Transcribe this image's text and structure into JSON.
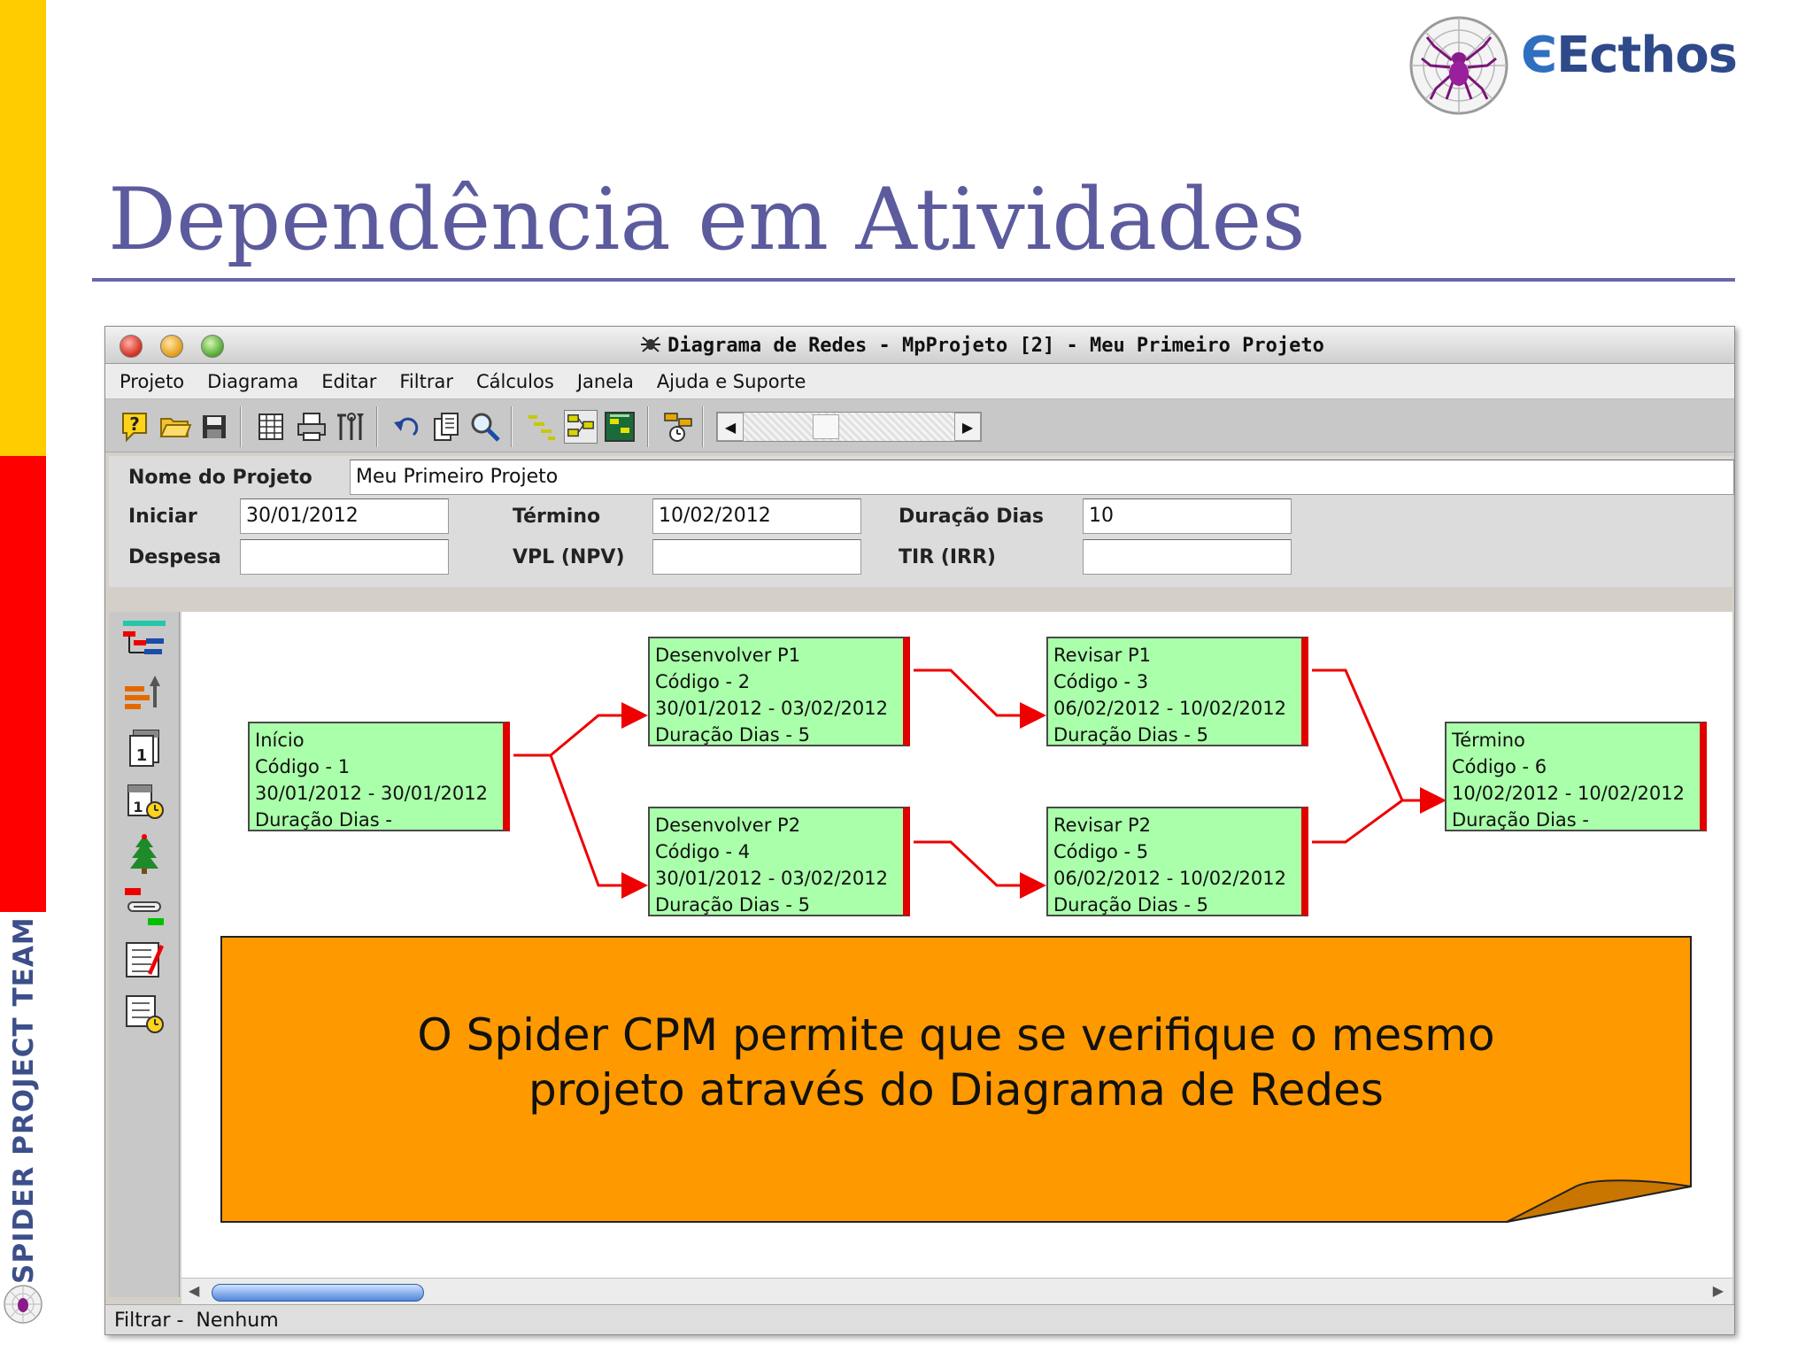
{
  "slide": {
    "title": "Dependência em Atividades",
    "logo_text": "Ecthos",
    "side_text": "SPIDER PROJECT TEAM"
  },
  "window": {
    "title": "Diagrama de Redes - MpProjeto [2] - Meu Primeiro Projeto",
    "menu": [
      "Projeto",
      "Diagrama",
      "Editar",
      "Filtrar",
      "Cálculos",
      "Janela",
      "Ajuda e Suporte"
    ],
    "project": {
      "name_label": "Nome do Projeto",
      "name_value": "Meu Primeiro Projeto",
      "start_label": "Iniciar",
      "start_value": "30/01/2012",
      "end_label": "Término",
      "end_value": "10/02/2012",
      "duration_label": "Duração Dias",
      "duration_value": "10",
      "expense_label": "Despesa",
      "expense_value": "",
      "npv_label": "VPL (NPV)",
      "npv_value": "",
      "irr_label": "TIR (IRR)",
      "irr_value": ""
    },
    "status": {
      "label": "Filtrar -",
      "value": "Nenhum"
    }
  },
  "network": {
    "nodes": [
      {
        "name": "Início",
        "code": "Código - 1",
        "dates": "30/01/2012  -  30/01/2012",
        "duration": "Duração Dias -"
      },
      {
        "name": "Desenvolver P1",
        "code": "Código - 2",
        "dates": "30/01/2012  -  03/02/2012",
        "duration": "Duração Dias - 5"
      },
      {
        "name": "Revisar P1",
        "code": "Código - 3",
        "dates": "06/02/2012  -  10/02/2012",
        "duration": "Duração Dias - 5"
      },
      {
        "name": "Desenvolver P2",
        "code": "Código - 4",
        "dates": "30/01/2012  -  03/02/2012",
        "duration": "Duração Dias - 5"
      },
      {
        "name": "Revisar P2",
        "code": "Código - 5",
        "dates": "06/02/2012  -  10/02/2012",
        "duration": "Duração Dias - 5"
      },
      {
        "name": "Término",
        "code": "Código - 6",
        "dates": "10/02/2012  -  10/02/2012",
        "duration": "Duração Dias -"
      }
    ]
  },
  "callout": {
    "line1": "O Spider CPM permite que se verifique o mesmo",
    "line2": "projeto através do Diagrama de Redes"
  },
  "colors": {
    "node_fill": "#aaffaa",
    "link": "#ee0000",
    "callout_fill": "#ff9900",
    "title": "#5c5b9e"
  },
  "icons": {
    "toolbar": [
      "help-icon",
      "open-folder-icon",
      "save-icon",
      "table-icon",
      "print-icon",
      "tools-icon",
      "undo-icon",
      "copy-icon",
      "zoom-icon",
      "gantt-icon",
      "network-diagram-icon",
      "resource-view-icon",
      "schedule-icon"
    ],
    "left": [
      "structure-icon",
      "resources-icon",
      "calendar-icon",
      "calendar-clock-icon",
      "tree-icon",
      "link-icon",
      "checklist-icon",
      "checklist-clock-icon"
    ]
  }
}
